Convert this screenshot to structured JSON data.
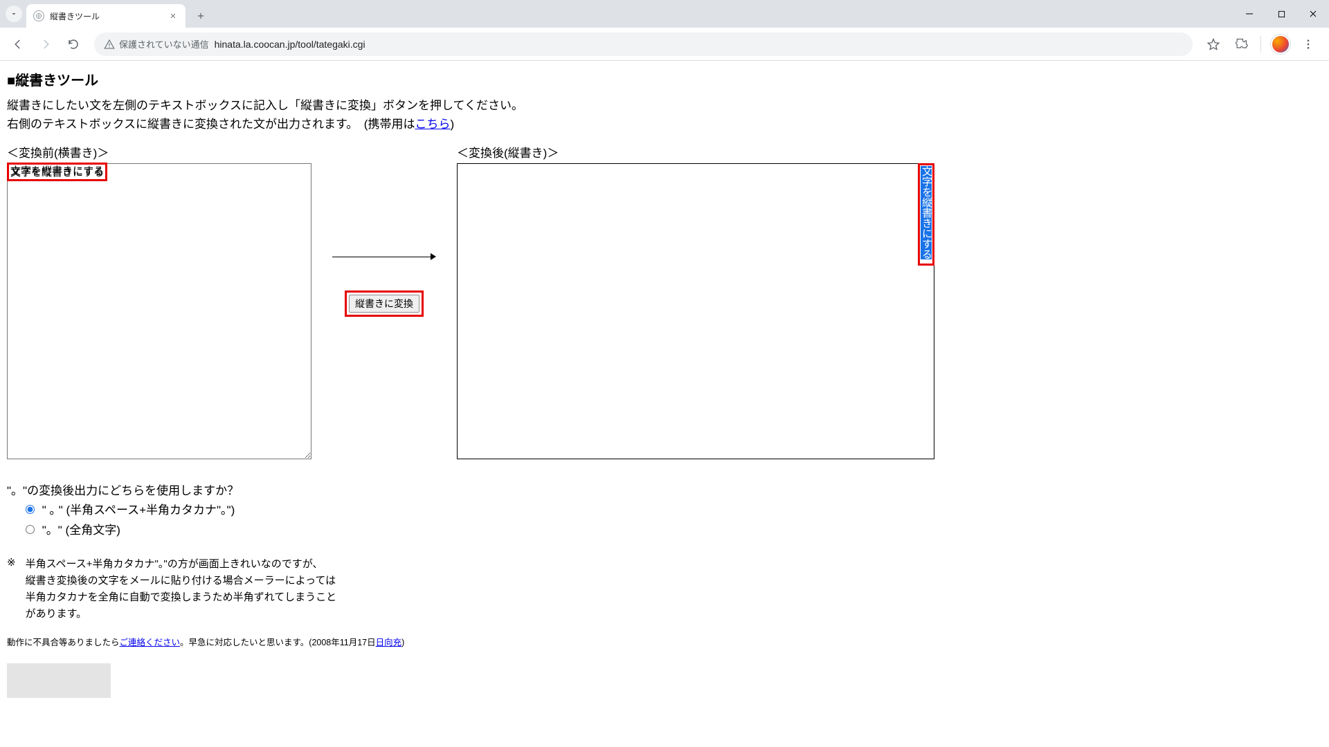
{
  "browser": {
    "tab_title": "縦書きツール",
    "security_label": "保護されていない通信",
    "url": "hinata.la.coocan.jp/tool/tategaki.cgi"
  },
  "page": {
    "heading": "■縦書きツール",
    "intro_line1": "縦書きにしたい文を左側のテキストボックスに記入し「縦書きに変換」ボタンを押してください。",
    "intro_line2_pre": "右側のテキストボックスに縦書きに変換された文が出力されます。　(携帯用は",
    "intro_link": "こちら",
    "intro_line2_post": ")",
    "before_label": "＜変換前(横書き)＞",
    "after_label": "＜変換後(縦書き)＞",
    "input_text": "文字を縦書きにする",
    "output_text": "文字を縦書きにする",
    "convert_button": "縦書きに変換",
    "options_question": "\"。\"の変換後出力にどちらを使用しますか？",
    "option1_label": "\" ｡ \" (半角スペース+半角カタカナ\"｡\")",
    "option2_label": "\"。\" (全角文字)",
    "note_symbol": "※",
    "note_line1": "半角スペース+半角カタカナ\"｡\"の方が画面上きれいなのですが、",
    "note_line2": "縦書き変換後の文字をメールに貼り付ける場合メーラーによっては",
    "note_line3": "半角カタカナを全角に自動で変換しまうため半角ずれてしまうこと",
    "note_line4": "があります。",
    "footer_pre": "動作に不具合等ありましたら",
    "footer_link1": "ご連絡ください",
    "footer_mid": "。早急に対応したいと思います。(2008年11月17日",
    "footer_link2": "日向充",
    "footer_post": ")"
  }
}
